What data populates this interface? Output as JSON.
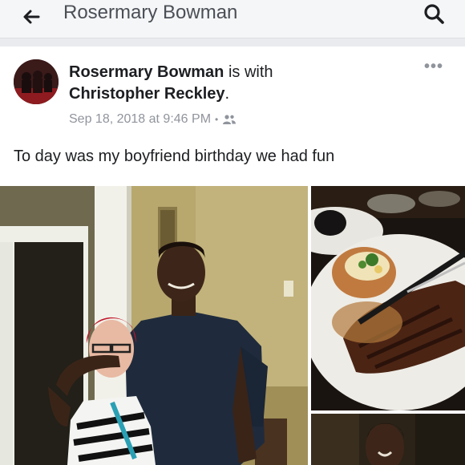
{
  "header": {
    "title": "Rosermary Bowman",
    "back_icon": "arrow-left-icon",
    "search_icon": "search-icon"
  },
  "post": {
    "author": "Rosermary Bowman",
    "with_text": " is with ",
    "tagged": "Christopher Reckley",
    "period": ".",
    "timestamp": "Sep 18, 2018 at 9:46 PM",
    "separator": "•",
    "audience_icon": "friends-icon",
    "more_label": "•••",
    "text": "To day was my boyfriend birthday we had fun"
  },
  "colors": {
    "header_bg": "#f5f6f7",
    "meta_text": "#90949c",
    "body_text": "#1c1e21"
  }
}
